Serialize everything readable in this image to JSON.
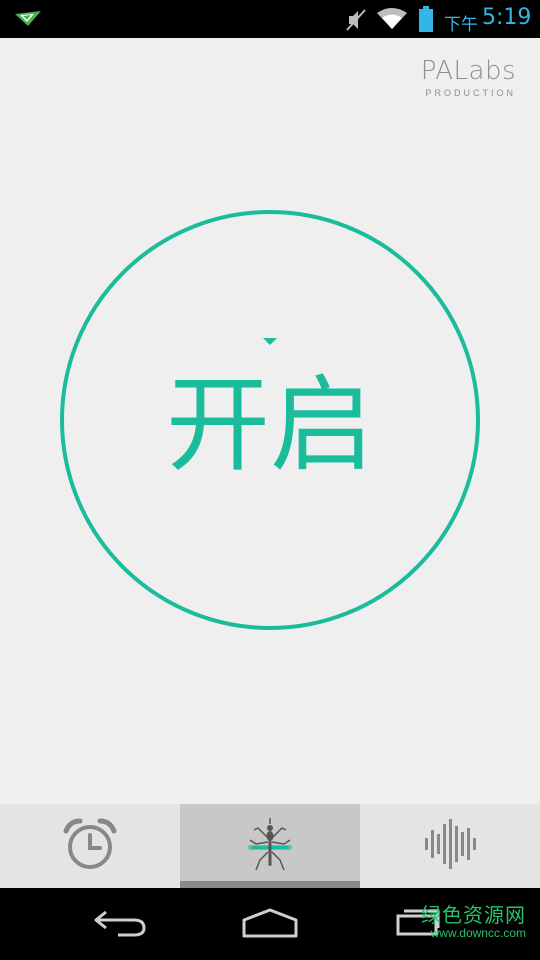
{
  "status_bar": {
    "ampm": "下午",
    "time": "5:19",
    "icons": [
      "notification-app-icon",
      "mute-icon",
      "wifi-icon",
      "battery-icon"
    ]
  },
  "brand": {
    "name": "PALabs",
    "tagline": "PRODUCTION"
  },
  "main": {
    "toggle_label": "开启",
    "accent_color": "#1abc9c"
  },
  "tabs": [
    {
      "icon": "alarm-clock-icon",
      "selected": false
    },
    {
      "icon": "mosquito-icon",
      "selected": true
    },
    {
      "icon": "sound-wave-icon",
      "selected": false
    }
  ],
  "nav": {
    "buttons": [
      "back-icon",
      "home-icon",
      "recent-apps-icon"
    ]
  },
  "watermark": {
    "main": "绿色资源网",
    "url": "www.downcc.com"
  }
}
